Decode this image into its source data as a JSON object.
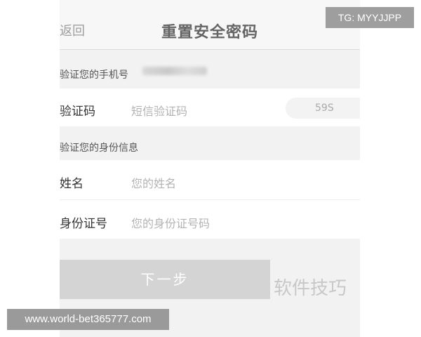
{
  "nav": {
    "back_label": "返回",
    "title": "重置安全密码",
    "more_icon": "ellipsis-icon"
  },
  "phone_section": {
    "label": "验证您的手机号",
    "masked_phone": ""
  },
  "sms_row": {
    "label": "验证码",
    "placeholder": "短信验证码",
    "countdown": "59S"
  },
  "identity_section": {
    "label": "验证您的身份信息"
  },
  "name_row": {
    "label": "姓名",
    "placeholder": "您的姓名"
  },
  "id_row": {
    "label": "身份证号",
    "placeholder": "您的身份证号码"
  },
  "next_button": {
    "label": "下一步"
  },
  "overlays": {
    "corner_tag": "TG: MYYJJPP",
    "watermark": "软件技巧",
    "url": "www.world-bet365777.com"
  },
  "colors": {
    "background": "#f2f2f2",
    "row": "#ffffff",
    "button_disabled": "#d4d4d4",
    "placeholder": "#b3b3b3"
  }
}
